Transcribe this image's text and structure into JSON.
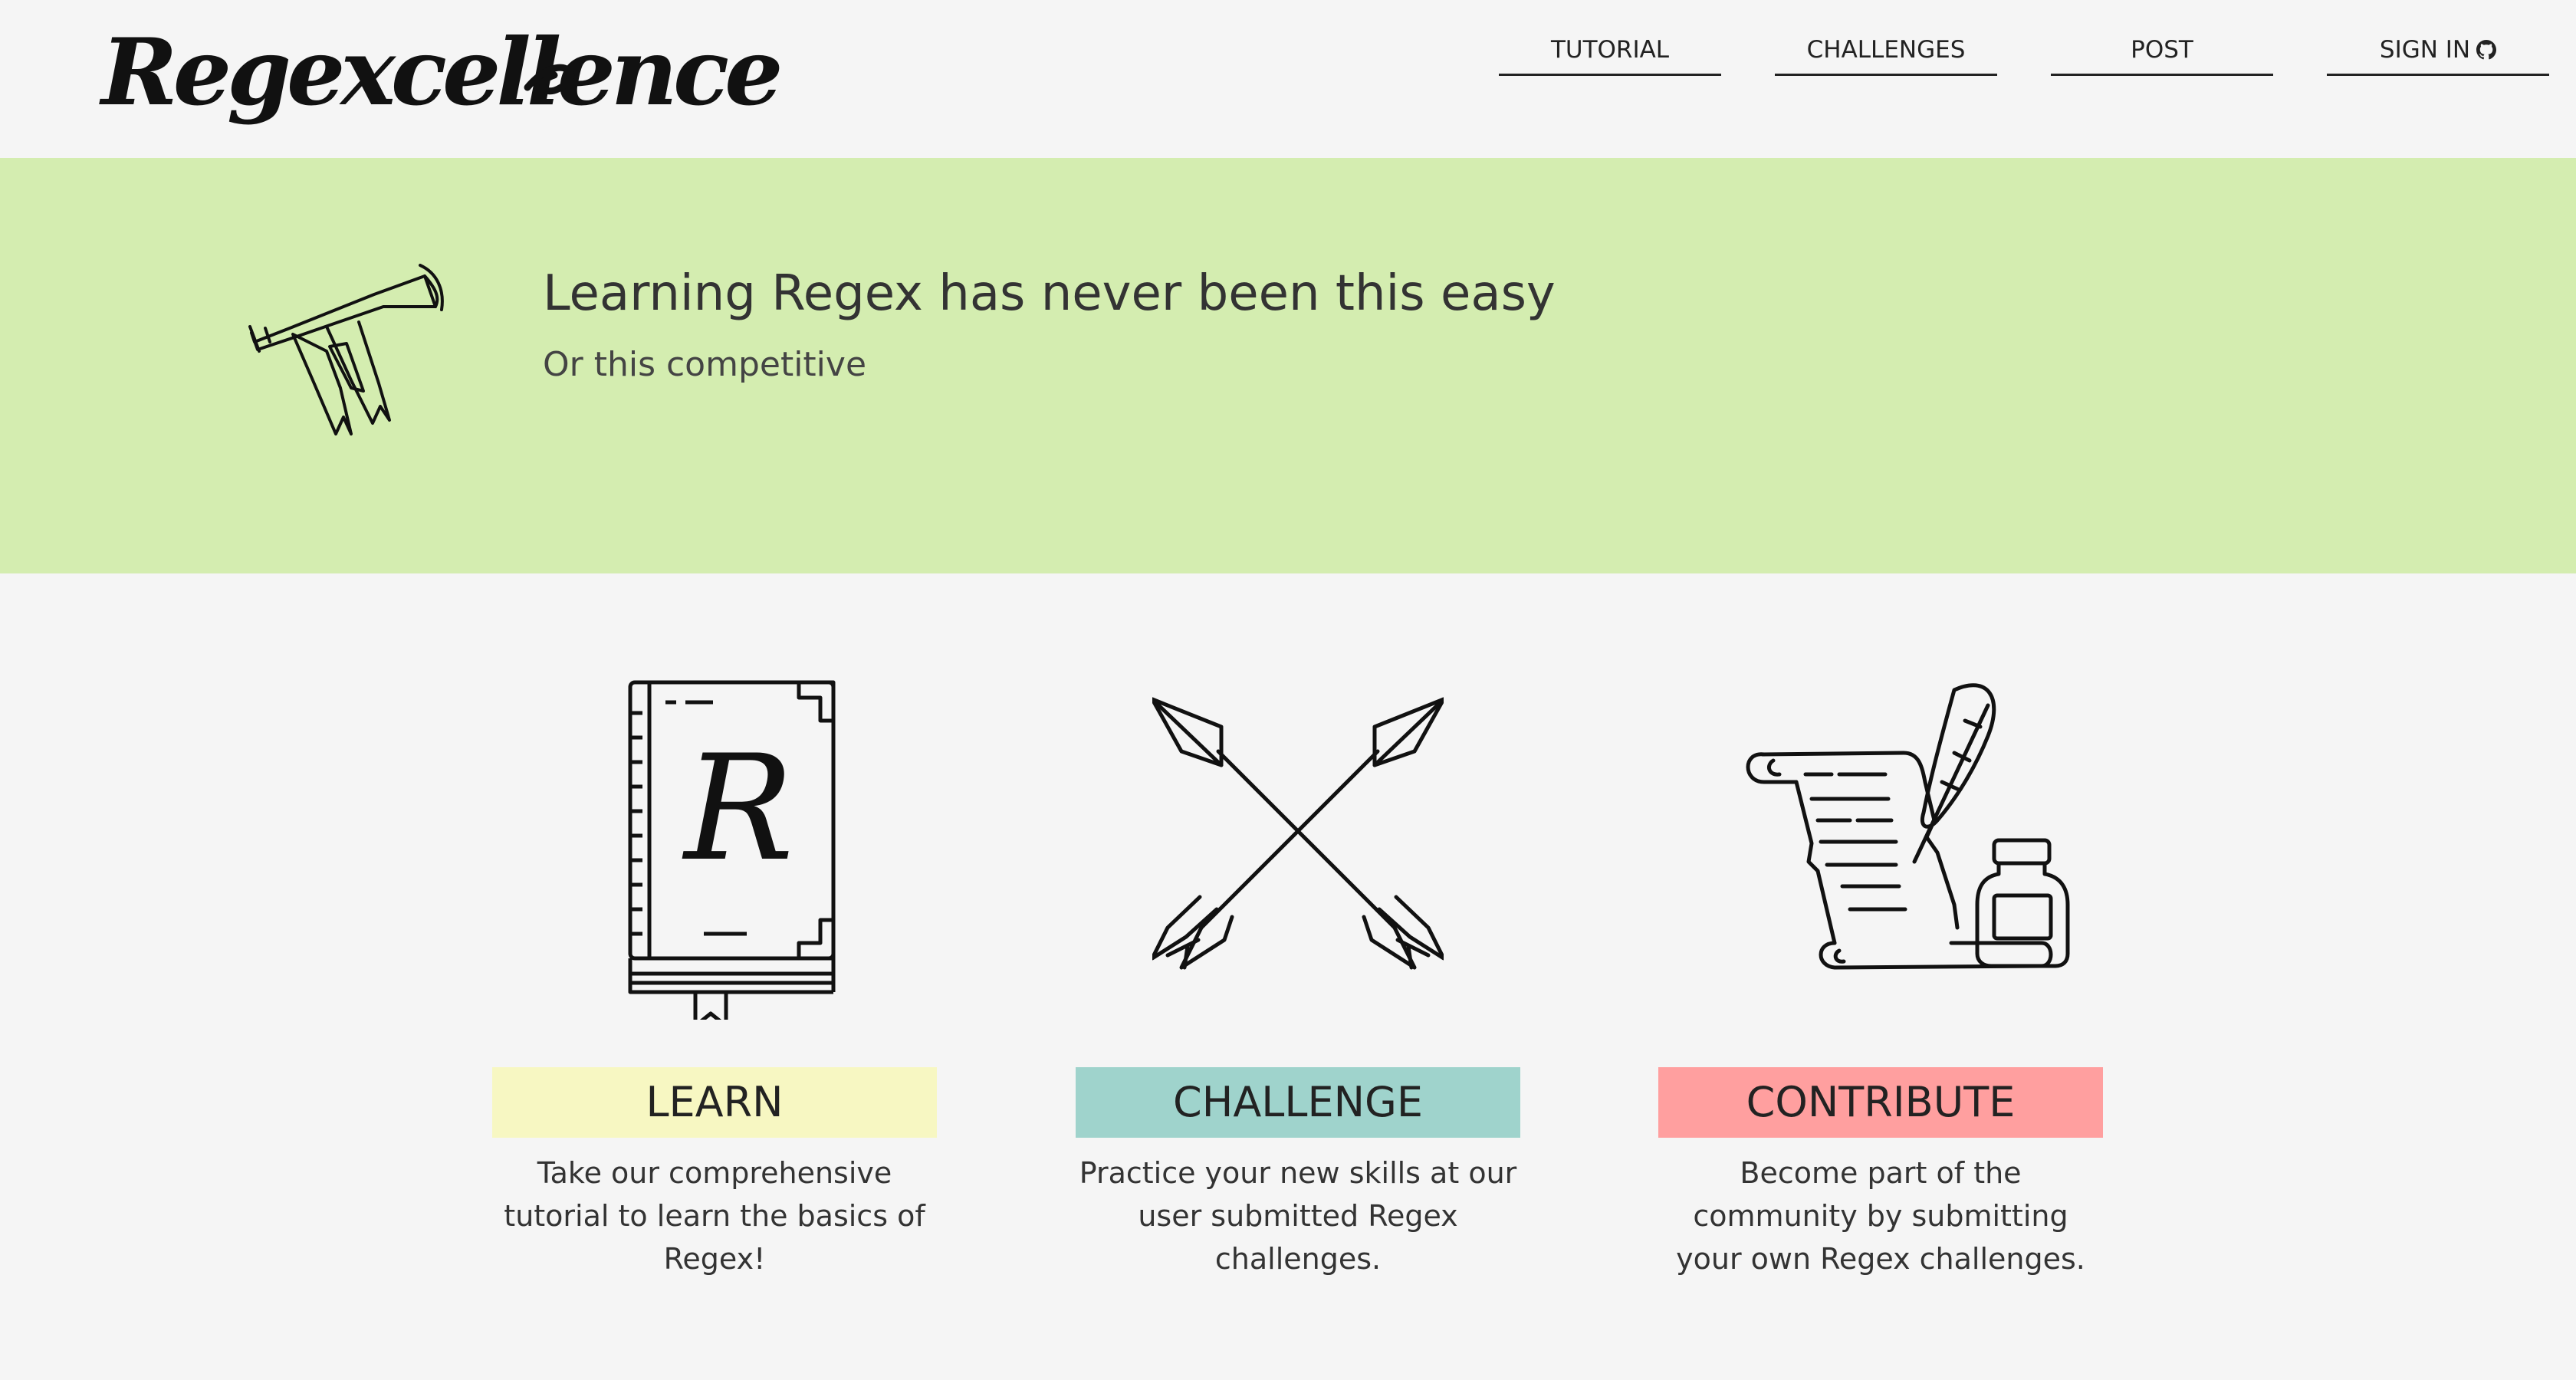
{
  "header": {
    "logo_text": "Regexcellence",
    "nav": [
      {
        "label": "TUTORIAL"
      },
      {
        "label": "CHALLENGES"
      },
      {
        "label": "POST"
      },
      {
        "label": "SIGN IN",
        "icon": "github-icon"
      }
    ]
  },
  "hero": {
    "title": "Learning Regex has never been this easy",
    "subtitle": "Or this competitive",
    "icon": "trumpet-banner-icon",
    "background": "#d4edb0"
  },
  "features": [
    {
      "icon": "book-icon",
      "book_letter": "R",
      "button_label": "LEARN",
      "button_color": "#f7f7c2",
      "description": "Take our comprehensive tutorial to learn the basics of Regex!"
    },
    {
      "icon": "crossed-arrows-icon",
      "button_label": "CHALLENGE",
      "button_color": "#9fd3cc",
      "description": "Practice your new skills at our user submitted Regex challenges."
    },
    {
      "icon": "scroll-quill-icon",
      "button_label": "CONTRIBUTE",
      "button_color": "#ff9f9f",
      "description": "Become part of the community by submitting your own Regex challenges."
    }
  ]
}
